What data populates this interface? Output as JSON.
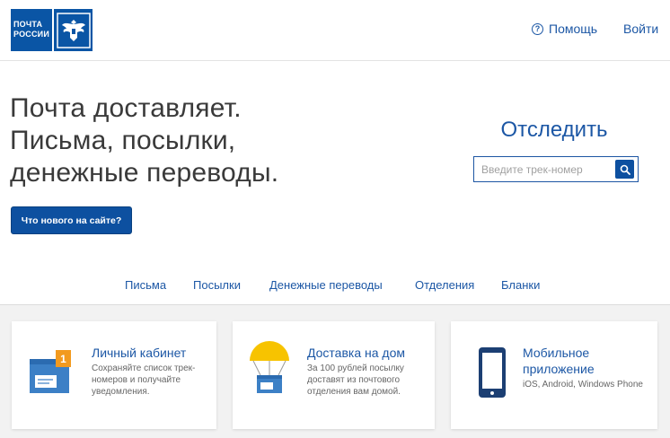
{
  "header": {
    "logo_line1": "ПОЧТА",
    "logo_line2": "РОССИИ",
    "help_label": "Помощь",
    "login_label": "Войти"
  },
  "hero": {
    "line1": "Почта доставляет.",
    "line2": "Письма, посылки,",
    "line3": "денежные переводы.",
    "news_button": "Что нового на сайте?"
  },
  "tracking": {
    "title": "Отследить",
    "placeholder": "Введите трек-номер"
  },
  "nav": {
    "items": [
      "Письма",
      "Посылки",
      "Денежные переводы",
      "Отделения",
      "Бланки"
    ]
  },
  "cards": [
    {
      "title": "Личный кабинет",
      "desc": "Сохраняйте список трек-номеров и получайте уведомления.",
      "badge": "1"
    },
    {
      "title": "Доставка на дом",
      "desc": "За 100 рублей посылку доставят из почтового отделения вам домой."
    },
    {
      "title": "Мобильное приложение",
      "desc": "iOS, Android, Windows Phone"
    }
  ],
  "colors": {
    "brand_blue": "#0a55a5",
    "link_blue": "#1c57a5",
    "badge_orange": "#f29a1f",
    "umbrella_yellow": "#f7c300"
  }
}
